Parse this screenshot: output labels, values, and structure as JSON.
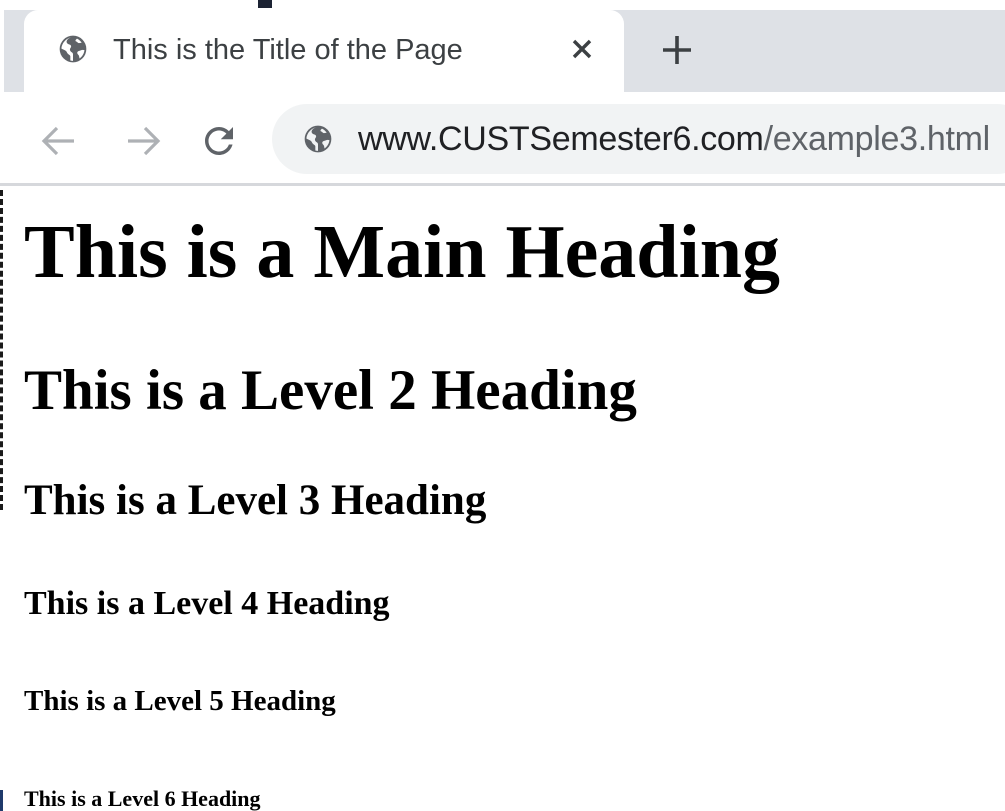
{
  "browser": {
    "tab": {
      "title": "This is the Title of the Page",
      "favicon_icon": "globe-icon",
      "close_icon": "close-icon"
    },
    "new_tab_icon": "plus-icon",
    "nav": {
      "back_icon": "arrow-left-icon",
      "forward_icon": "arrow-right-icon",
      "reload_icon": "reload-icon"
    },
    "address_bar": {
      "site_icon": "globe-icon",
      "url_host": "www.CUSTSemester6.com",
      "url_path": "/example3.html"
    },
    "colors": {
      "tabstrip_bg": "#dee1e6",
      "omnibox_bg": "#f1f3f4",
      "icon_gray": "#5f6368"
    }
  },
  "page": {
    "headings": {
      "h1": "This is a Main Heading",
      "h2": "This is a Level 2 Heading",
      "h3": "This is a Level 3 Heading",
      "h4": "This is a Level 4 Heading",
      "h5": "This is a Level 5 Heading",
      "h6": "This is a Level 6 Heading"
    }
  }
}
